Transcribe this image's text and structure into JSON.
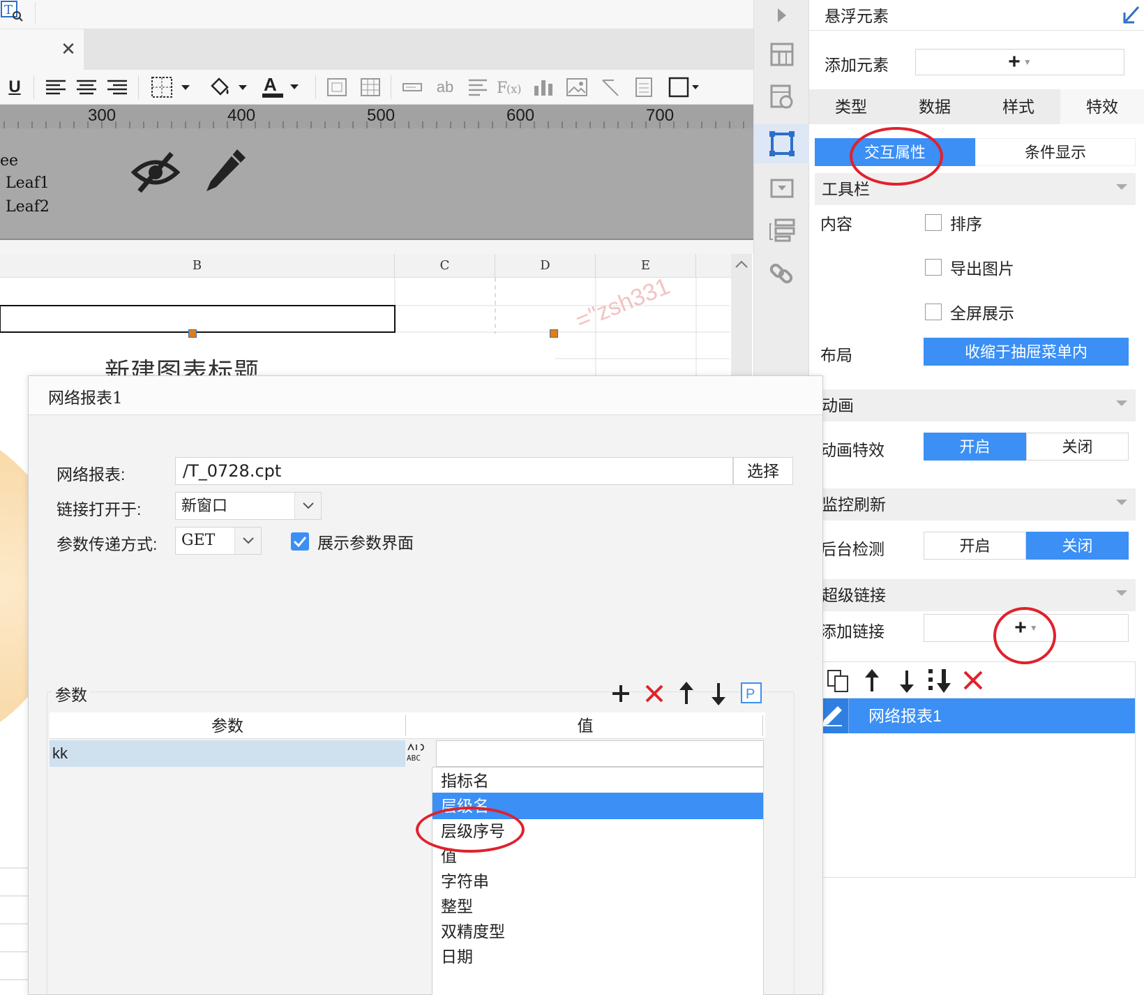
{
  "toolbar": {
    "underline_label": "U",
    "text_format_label": "ab"
  },
  "tab": {
    "close_glyph": "✕"
  },
  "ruler": {
    "labels": [
      "300",
      "400",
      "500",
      "600",
      "700"
    ]
  },
  "tree": {
    "root_partial": "ee",
    "leaf1": "Leaf1",
    "leaf2": "Leaf2"
  },
  "sheet": {
    "columns": [
      "B",
      "C",
      "D",
      "E"
    ],
    "chart_title": "新建图表标题",
    "watermark": "=\"zsh331"
  },
  "right_panel": {
    "title": "悬浮元素",
    "add_element_label": "添加元素",
    "add_element_button": "+",
    "tabs": [
      "类型",
      "数据",
      "样式",
      "特效"
    ],
    "sub_tabs": [
      "交互属性",
      "条件显示"
    ],
    "toolbar_section": "工具栏",
    "content_label": "内容",
    "content_options": [
      "排序",
      "导出图片",
      "全屏展示"
    ],
    "layout_label": "布局",
    "layout_value": "收缩于抽屉菜单内",
    "animation_section": "动画",
    "animation_effect_label": "动画特效",
    "on_label": "开启",
    "off_label": "关闭",
    "monitor_section": "监控刷新",
    "backend_detect_label": "后台检测",
    "hyperlink_section": "超级链接",
    "add_link_label": "添加链接",
    "add_link_button": "+",
    "link_items": [
      "网络报表1"
    ]
  },
  "dialog": {
    "title": "网络报表1",
    "report_label": "网络报表:",
    "report_value": "/T_0728.cpt",
    "choose_button": "选择",
    "open_in_label": "链接打开于:",
    "open_in_value": "新窗口",
    "param_method_label": "参数传递方式:",
    "param_method_value": "GET",
    "show_param_label": "展示参数界面",
    "show_param_checked": true,
    "params_legend": "参数",
    "param_col": "参数",
    "value_col": "值",
    "param_rows": [
      {
        "name": "kk"
      }
    ],
    "type_icon_text": "ABC",
    "value_options": [
      "指标名",
      "层级名",
      "层级序号",
      "值",
      "字符串",
      "整型",
      "双精度型",
      "日期"
    ],
    "selected_option": "层级名"
  },
  "colors": {
    "accent_blue": "#3b8ff5",
    "highlight_red": "#e0212c",
    "handle_orange": "#e07e14"
  }
}
